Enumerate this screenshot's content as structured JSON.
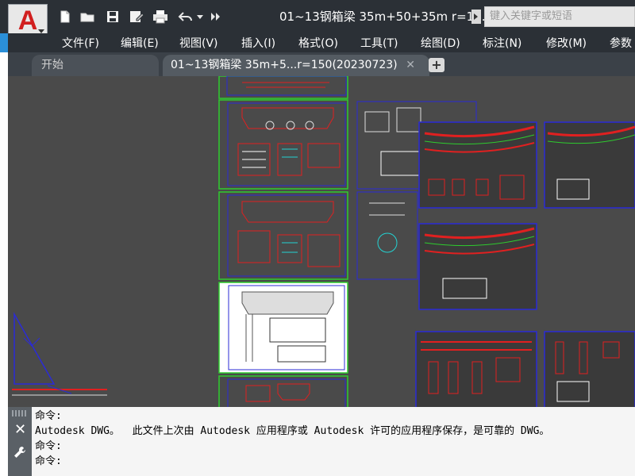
{
  "app": {
    "logo_letter": "A",
    "title": "01~13钢箱梁 35m+50+35m r=1...",
    "search_placeholder": "键入关键字或短语"
  },
  "quick_access": [
    {
      "name": "new-icon"
    },
    {
      "name": "open-icon"
    },
    {
      "name": "save-icon"
    },
    {
      "name": "saveas-icon"
    },
    {
      "name": "print-icon"
    },
    {
      "name": "undo-icon"
    },
    {
      "name": "more-icon"
    }
  ],
  "menu": [
    "文件(F)",
    "编辑(E)",
    "视图(V)",
    "插入(I)",
    "格式(O)",
    "工具(T)",
    "绘图(D)",
    "标注(N)",
    "修改(M)",
    "参数"
  ],
  "tabs": {
    "start": "开始",
    "document": "01~13钢箱梁 35m+5...r=150(20230723)",
    "close": "✕",
    "add": "+"
  },
  "command": {
    "lines": [
      "命令:",
      "Autodesk DWG。  此文件上次由 Autodesk 应用程序或 Autodesk 许可的应用程序保存，是可靠的 DWG。",
      "命令:",
      "命令:"
    ]
  },
  "colors": {
    "accent_red": "#d11f1f",
    "canvas": "#4a4a4a",
    "sheet_border_green": "#2ecc2e",
    "sheet_border_blue": "#2b2bd6"
  }
}
